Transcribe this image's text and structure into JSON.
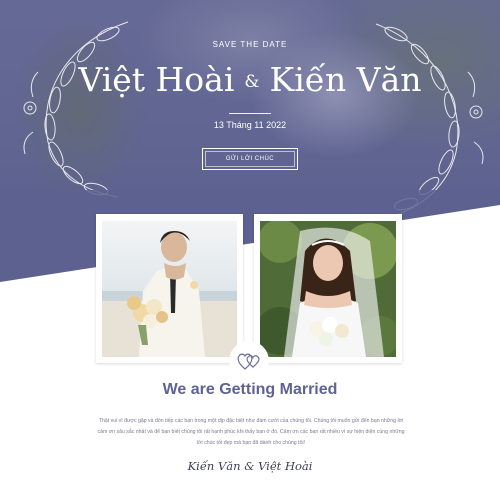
{
  "hero": {
    "kicker": "SAVE THE DATE",
    "name_left": "Việt Hoài",
    "ampersand": "&",
    "name_right": "Kiến Văn",
    "date": "13 Tháng 11 2022",
    "button_label": "GỬI LỜI CHÚC"
  },
  "photos": {
    "groom_icon": "groom-photo",
    "bride_icon": "bride-photo",
    "badge_icon": "hearts-icon"
  },
  "section": {
    "title": "We are Getting Married",
    "paragraph": "Thật vui vì được gặp và đón tiếp các bạn trong một dịp đặc biệt như đám cưới của chúng tôi. Chúng tôi muốn gửi đến bạn những lời cảm ơn sâu sắc nhất và để bạn biết chúng tôi rất hạnh phúc khi thấy bạn ở đó. Cảm ơn các bạn rất nhiều vì sự hiện diện cùng những lời chúc tốt đẹp mà bạn đã dành cho chúng tôi!",
    "signature": "Kiến Văn & Việt Hoài"
  },
  "colors": {
    "accent": "#5f6394",
    "hero_overlay": "#5d6190",
    "text_muted": "#7b7b95"
  }
}
